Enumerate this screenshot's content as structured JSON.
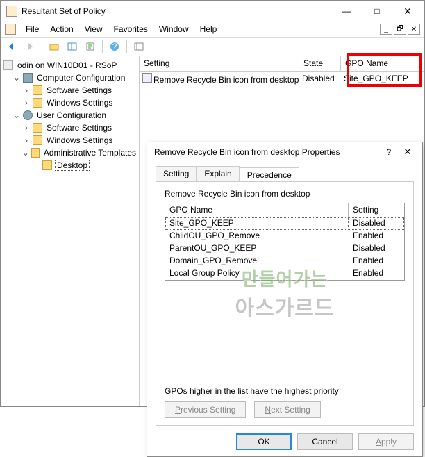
{
  "window": {
    "title": "Resultant Set of Policy",
    "sys": {
      "min": "—",
      "max": "□",
      "close": "✕"
    },
    "small": {
      "restore": "🗗",
      "close": "✕"
    }
  },
  "menus": [
    "File",
    "Action",
    "View",
    "Favorites",
    "Window",
    "Help"
  ],
  "tree": {
    "root": "odin on WIN10D01 - RSoP",
    "comp": "Computer Configuration",
    "software": "Software Settings",
    "windows": "Windows Settings",
    "user": "User Configuration",
    "adm": "Administrative Templates",
    "desktop": "Desktop"
  },
  "list": {
    "cols": {
      "setting": "Setting",
      "state": "State",
      "gpo": "GPO Name"
    },
    "row": {
      "setting": "Remove Recycle Bin icon from desktop",
      "state": "Disabled",
      "gpo": "Site_GPO_KEEP"
    }
  },
  "dialog": {
    "title": "Remove Recycle Bin icon from desktop Properties",
    "help": "?",
    "close": "✕",
    "tabs": {
      "setting": "Setting",
      "explain": "Explain",
      "precedence": "Precedence"
    },
    "sub": "Remove Recycle Bin icon from desktop",
    "gridcols": {
      "gpo": "GPO Name",
      "setting": "Setting"
    },
    "rows": [
      {
        "gpo": "Site_GPO_KEEP",
        "setting": "Disabled"
      },
      {
        "gpo": "ChildOU_GPO_Remove",
        "setting": "Enabled"
      },
      {
        "gpo": "ParentOU_GPO_KEEP",
        "setting": "Disabled"
      },
      {
        "gpo": "Domain_GPO_Remove",
        "setting": "Enabled"
      },
      {
        "gpo": "Local Group Policy",
        "setting": "Enabled"
      }
    ],
    "hint": "GPOs higher in the list have the highest priority",
    "prev": "Previous Setting",
    "next": "Next Setting",
    "ok": "OK",
    "cancel": "Cancel",
    "apply": "Apply"
  },
  "watermark": {
    "line1": "만들어가는",
    "line2": "아스가르드"
  }
}
